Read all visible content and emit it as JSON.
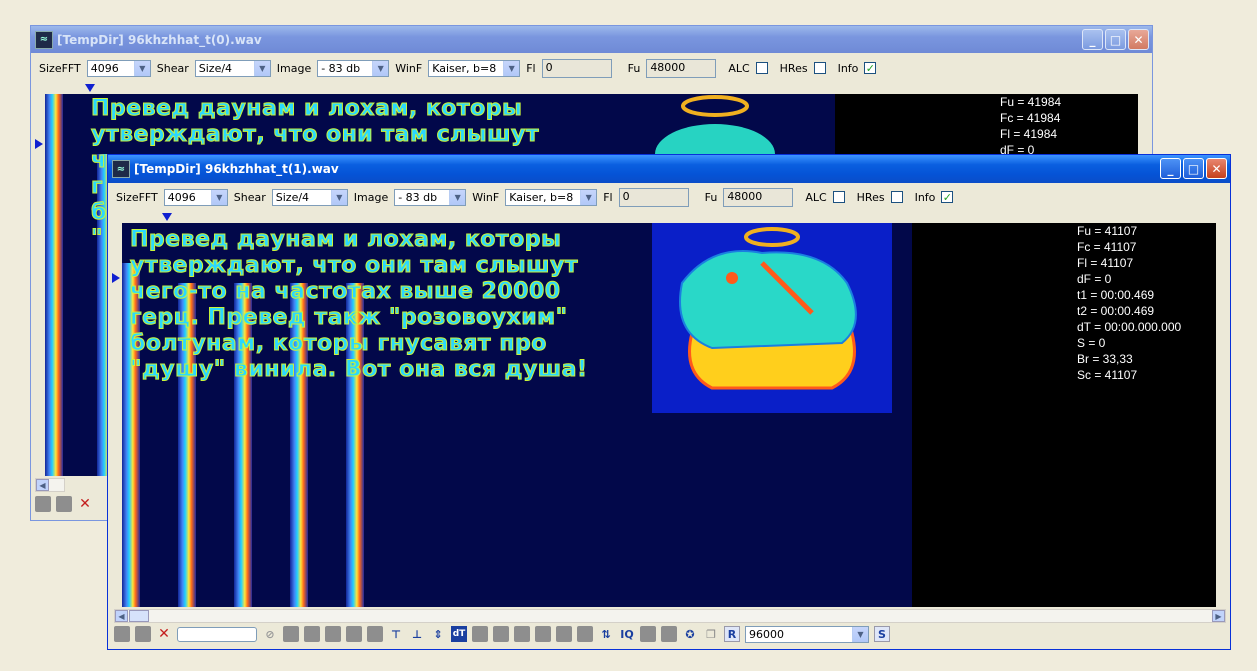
{
  "windows": {
    "back": {
      "title": "[TempDir] 96khzhhat_t(0).wav",
      "toolbar": {
        "sizefft_label": "SizeFFT",
        "sizefft_value": "4096",
        "shear_label": "Shear",
        "shear_value": "Size/4",
        "image_label": "Image",
        "image_value": "- 83 db",
        "winf_label": "WinF",
        "winf_value": "Kaiser, b=8",
        "fl_label": "Fl",
        "fl_value": "0",
        "fu_label": "Fu",
        "fu_value": "48000",
        "alc_label": "ALC",
        "hres_label": "HRes",
        "info_label": "Info"
      },
      "overlay_lines": [
        "Превед даунам и лохам, которы",
        "утверждают, что они там слышут",
        "ч",
        "г",
        "б",
        "\""
      ],
      "info_lines": [
        "Fu = 41984",
        "Fc = 41984",
        "Fl = 41984",
        "dF = 0"
      ]
    },
    "front": {
      "title": "[TempDir] 96khzhhat_t(1).wav",
      "toolbar": {
        "sizefft_label": "SizeFFT",
        "sizefft_value": "4096",
        "shear_label": "Shear",
        "shear_value": "Size/4",
        "image_label": "Image",
        "image_value": "- 83 db",
        "winf_label": "WinF",
        "winf_value": "Kaiser, b=8",
        "fl_label": "Fl",
        "fl_value": "0",
        "fu_label": "Fu",
        "fu_value": "48000",
        "alc_label": "ALC",
        "hres_label": "HRes",
        "info_label": "Info"
      },
      "overlay_lines": [
        "Превед даунам и лохам, которы",
        "утверждают, что они там слышут",
        "чего-то на частотах выше 20000",
        "герц. Превед такж \"розовоухим\"",
        "болтунам, которы гнусавят про",
        "\"душу\" винила. Вот она вся душа!"
      ],
      "info_lines": [
        "Fu = 41107",
        "Fc = 41107",
        "Fl = 41107",
        "dF = 0",
        "t1 = 00:00.469",
        "t2 = 00:00.469",
        "dT = 00:00.000.000",
        "S = 0",
        "Br = 33,33",
        "Sc = 41107"
      ],
      "bottom": {
        "rate_value": "96000",
        "dt_label": "dT",
        "r_label": "R",
        "s_label": "S",
        "input_value": ""
      }
    }
  },
  "colors": {
    "spectrum_bg": "#02084a",
    "text_fill": "#2ad8ff",
    "text_stroke": "#c8f43a",
    "marker": "#1020d0"
  },
  "checkbox_states": {
    "alc": false,
    "hres": false,
    "info": true
  }
}
